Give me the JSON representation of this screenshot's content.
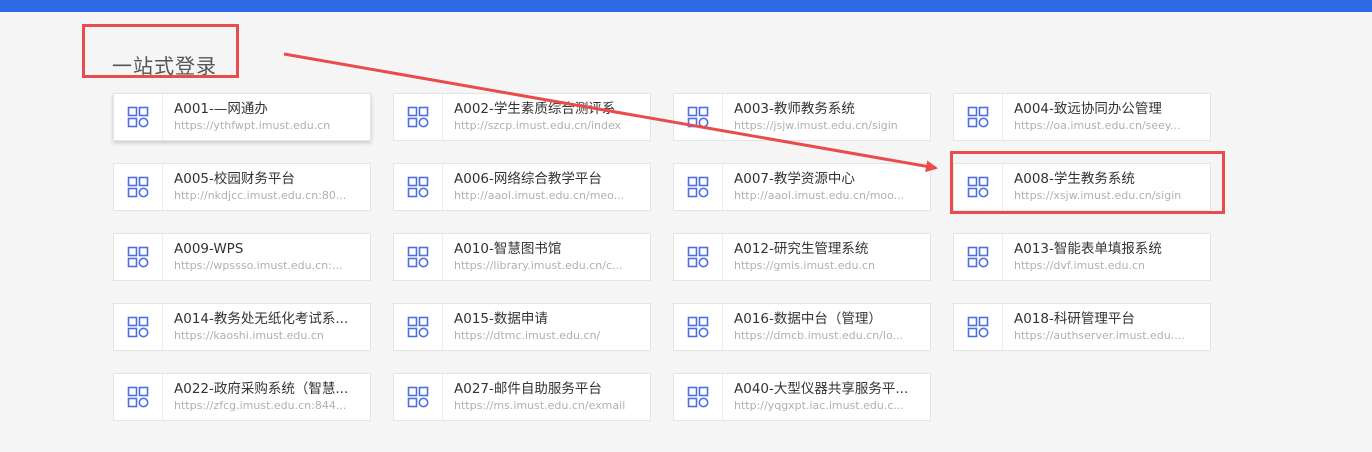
{
  "section": {
    "title": "一站式登录"
  },
  "colors": {
    "topbar": "#2f6ae6",
    "icon": "#4d6fe0",
    "annotation": "#e84c4c"
  },
  "apps": [
    {
      "name": "A001-—网通办",
      "url": "https://ythfwpt.imust.edu.cn",
      "icon": "grid-apps-icon"
    },
    {
      "name": "A002-学生素质综合测评系",
      "url": "http://szcp.imust.edu.cn/index",
      "icon": "grid-apps-icon"
    },
    {
      "name": "A003-教师教务系统",
      "url": "https://jsjw.imust.edu.cn/sigin",
      "icon": "grid-apps-icon"
    },
    {
      "name": "A004-致远协同办公管理",
      "url": "https://oa.imust.edu.cn/seey...",
      "icon": "grid-apps-icon"
    },
    {
      "name": "A005-校园财务平台",
      "url": "http://nkdjcc.imust.edu.cn:80...",
      "icon": "grid-apps-icon"
    },
    {
      "name": "A006-网络综合教学平台",
      "url": "http://aaol.imust.edu.cn/meo...",
      "icon": "grid-apps-icon"
    },
    {
      "name": "A007-教学资源中心",
      "url": "http://aaol.imust.edu.cn/moo...",
      "icon": "grid-apps-icon"
    },
    {
      "name": "A008-学生教务系统",
      "url": "https://xsjw.imust.edu.cn/sigin",
      "icon": "grid-apps-icon"
    },
    {
      "name": "A009-WPS",
      "url": "https://wpssso.imust.edu.cn:...",
      "icon": "grid-apps-icon"
    },
    {
      "name": "A010-智慧图书馆",
      "url": "https://library.imust.edu.cn/c...",
      "icon": "grid-apps-icon"
    },
    {
      "name": "A012-研究生管理系统",
      "url": "https://gmis.imust.edu.cn",
      "icon": "grid-apps-icon"
    },
    {
      "name": "A013-智能表单填报系统",
      "url": "https://dvf.imust.edu.cn",
      "icon": "grid-apps-icon"
    },
    {
      "name": "A014-教务处无纸化考试系...",
      "url": "https://kaoshi.imust.edu.cn",
      "icon": "grid-apps-icon"
    },
    {
      "name": "A015-数据申请",
      "url": "https://dtmc.imust.edu.cn/",
      "icon": "grid-apps-icon"
    },
    {
      "name": "A016-数据中台（管理）",
      "url": "https://dmcb.imust.edu.cn/lo...",
      "icon": "grid-apps-icon"
    },
    {
      "name": "A018-科研管理平台",
      "url": "https://authserver.imust.edu....",
      "icon": "grid-apps-icon"
    },
    {
      "name": "A022-政府采购系统（智慧...",
      "url": "https://zfcg.imust.edu.cn:844...",
      "icon": "grid-apps-icon"
    },
    {
      "name": "A027-邮件自助服务平台",
      "url": "https://ms.imust.edu.cn/exmail",
      "icon": "grid-apps-icon"
    },
    {
      "name": "A040-大型仪器共享服务平...",
      "url": "http://yqgxpt.iac.imust.edu.c...",
      "icon": "grid-apps-icon"
    }
  ]
}
